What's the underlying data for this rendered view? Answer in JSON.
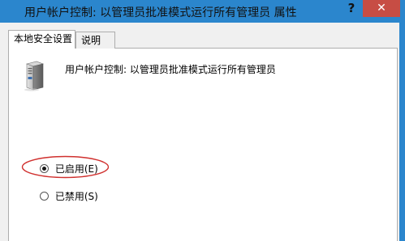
{
  "window": {
    "title": "用户帐户控制: 以管理员批准模式运行所有管理员 属性",
    "help_label": "?",
    "close_label": "✕"
  },
  "tabs": [
    {
      "label": "本地安全设置",
      "active": true
    },
    {
      "label": "说明",
      "active": false
    }
  ],
  "policy": {
    "icon": "server-icon",
    "name": "用户帐户控制: 以管理员批准模式运行所有管理员"
  },
  "options": [
    {
      "label": "已启用(E)",
      "selected": true
    },
    {
      "label": "已禁用(S)",
      "selected": false
    }
  ],
  "colors": {
    "titlebar": "#2b86cd",
    "close_button": "#c74d44",
    "highlight_ellipse": "#d0302e"
  }
}
